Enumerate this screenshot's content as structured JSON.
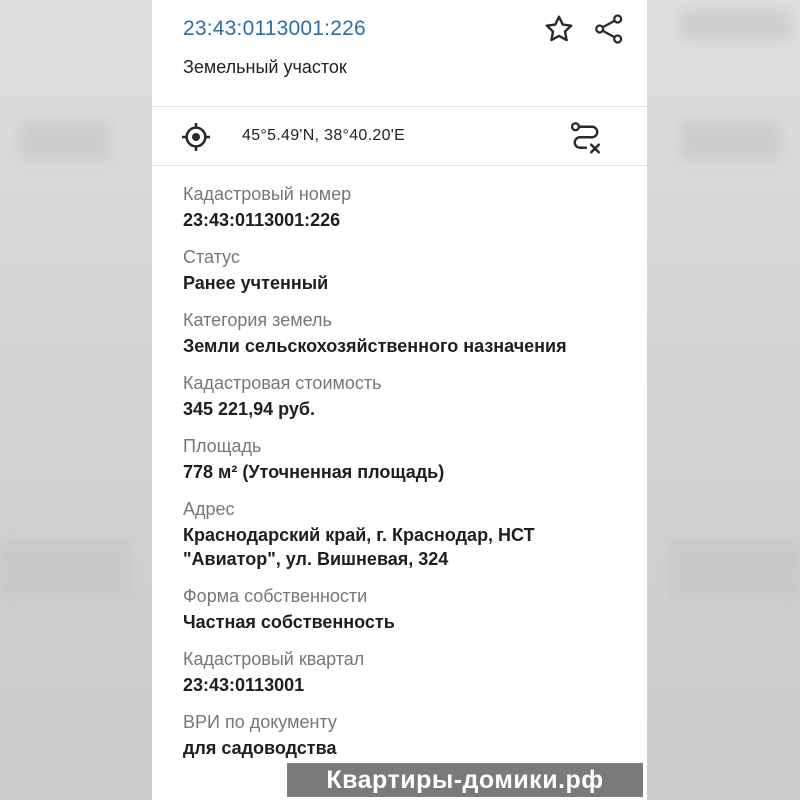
{
  "header": {
    "cadastral_link": "23:43:0113001:226",
    "object_type": "Земельный участок",
    "favorite_icon": "star-icon",
    "share_icon": "share-icon"
  },
  "coord_bar": {
    "locate_icon": "crosshair-icon",
    "coordinates": "45°5.49'N, 38°40.20'E",
    "route_icon": "route-cancel-icon"
  },
  "fields": [
    {
      "label": "Кадастровый номер",
      "value": "23:43:0113001:226"
    },
    {
      "label": "Статус",
      "value": "Ранее учтенный"
    },
    {
      "label": "Категория земель",
      "value": "Земли сельскохозяйственного назначения"
    },
    {
      "label": "Кадастровая стоимость",
      "value": "345 221,94 руб."
    },
    {
      "label": "Площадь",
      "value": "778 м² (Уточненная площадь)"
    },
    {
      "label": "Адрес",
      "value": "Краснодарский край, г. Краснодар, НСТ \"Авиатор\", ул. Вишневая, 324"
    },
    {
      "label": "Форма собственности",
      "value": "Частная собственность"
    },
    {
      "label": "Кадастровый квартал",
      "value": "23:43:0113001"
    },
    {
      "label": "ВРИ по документу",
      "value": "для садоводства"
    }
  ],
  "watermark": "Квартиры-домики.рф",
  "colors": {
    "link": "#2c6da8",
    "label": "#777777",
    "value": "#1e1e1e"
  }
}
